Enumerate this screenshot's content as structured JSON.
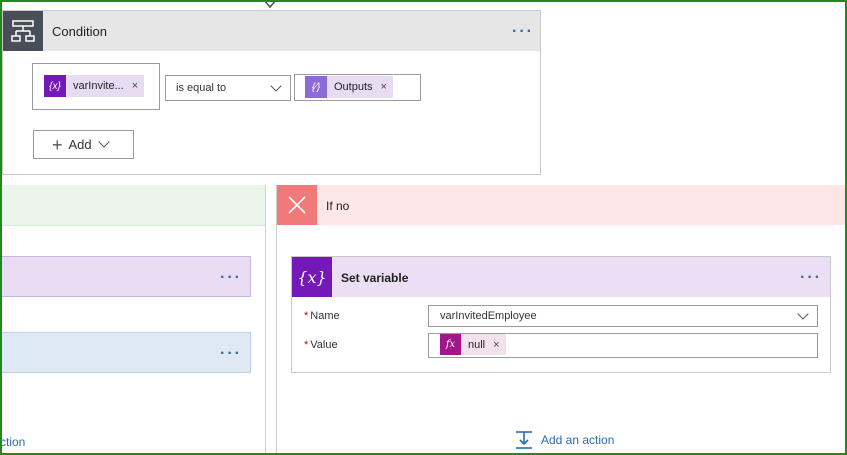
{
  "condition": {
    "title": "Condition",
    "more_label": "···",
    "left_token": {
      "label": "varInvite...",
      "remove": "×",
      "icon_text": "{x}"
    },
    "operator": "is equal to",
    "right_token": {
      "label": "Outputs",
      "remove": "×",
      "icon_text": "{⁄}"
    },
    "add_label": "Add"
  },
  "left_branch": {
    "card1_more": "···",
    "card2_more": "···",
    "add_action_label": "ction"
  },
  "right_branch": {
    "label": "If no",
    "set_variable": {
      "title": "Set variable",
      "more_label": "···",
      "name_label": "Name",
      "name_value": "varInvitedEmployee",
      "value_label": "Value",
      "required_mark": "*",
      "value_token": {
        "label": "null",
        "remove": "×",
        "icon_text": "fx"
      },
      "icon_text": "{x}"
    },
    "add_action_label": "Add an action"
  },
  "colors": {
    "accent_blue": "#2b6cb0",
    "variable_purple": "#7418b8",
    "if_no_red": "#f07a7a",
    "if_yes_green": "#eaf6ea",
    "frame_green": "#1f8b1f"
  }
}
